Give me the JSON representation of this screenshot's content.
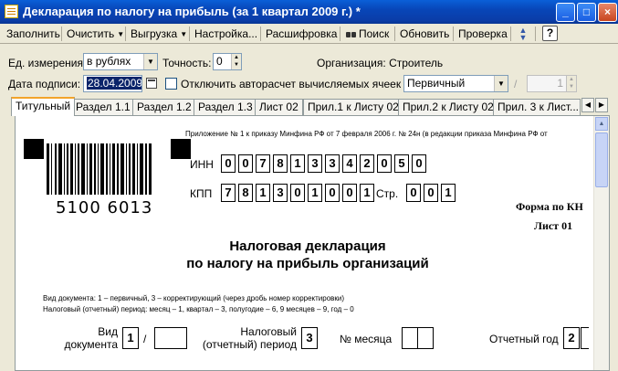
{
  "window": {
    "title": "Декларация по налогу на прибыль (за 1 квартал 2009 г.) *",
    "minimize": "_",
    "maximize": "□",
    "close": "×"
  },
  "toolbar": {
    "fill": "Заполнить",
    "clear": "Очистить",
    "export": "Выгрузка",
    "settings": "Настройка...",
    "decode": "Расшифровка",
    "search": "Поиск",
    "refresh": "Обновить",
    "check": "Проверка",
    "help": "?"
  },
  "form": {
    "unit_label": "Ед. измерения:",
    "unit_value": "в рублях",
    "precision_label": "Точность:",
    "precision_value": "0",
    "org_label": "Организация:",
    "org_value": "Строитель",
    "sign_date_label": "Дата подписи:",
    "sign_date_value": "28.04.2009",
    "autocalc_label": "Отключить авторасчет вычисляемых ячеек",
    "doc_kind_value": "Первичный",
    "slash": "/",
    "correction_value": "1"
  },
  "tabs": [
    {
      "label": "Титульный"
    },
    {
      "label": "Раздел 1.1"
    },
    {
      "label": "Раздел 1.2"
    },
    {
      "label": "Раздел 1.3"
    },
    {
      "label": "Лист 02"
    },
    {
      "label": "Прил.1 к Листу 02"
    },
    {
      "label": "Прил.2 к Листу 02"
    },
    {
      "label": "Прил. 3 к Лист..."
    }
  ],
  "doc": {
    "order_note": "Приложение № 1 к приказу Минфина РФ от 7 февраля 2006 г. № 24н (в редакции приказа Минфина РФ от",
    "barcode_number": "5100 6013",
    "inn_label": "ИНН",
    "inn_digits": [
      "0",
      "0",
      "7",
      "8",
      "1",
      "3",
      "3",
      "4",
      "2",
      "0",
      "5",
      "0"
    ],
    "kpp_label": "КПП",
    "kpp_digits": [
      "7",
      "8",
      "1",
      "3",
      "0",
      "1",
      "0",
      "0",
      "1"
    ],
    "page_label": "Стр.",
    "page_digits": [
      "0",
      "0",
      "1"
    ],
    "form_label": "Форма по КН",
    "sheet_label": "Лист 01",
    "title_line1": "Налоговая декларация",
    "title_line2": "по налогу на прибыль организаций",
    "note_doc_kind": "Вид документа: 1 – первичный, 3 – корректирующий (через дробь номер корректировки)",
    "note_period": "Налоговый (отчетный) период: месяц – 1, квартал – 3, полугодие – 6, 9 месяцев – 9, год – 0",
    "doc_kind_label_1": "Вид",
    "doc_kind_label_2": "документа",
    "doc_kind_digit": "1",
    "doc_kind_slash": "/",
    "period_label_1": "Налоговый",
    "period_label_2": "(отчетный) период",
    "period_digit": "3",
    "month_label": "№ месяца",
    "year_label": "Отчетный год",
    "year_digit": "2"
  },
  "icons": {
    "arrow_down": "▼",
    "arrow_up": "▲",
    "arrow_left": "◀",
    "arrow_right": "▶"
  }
}
